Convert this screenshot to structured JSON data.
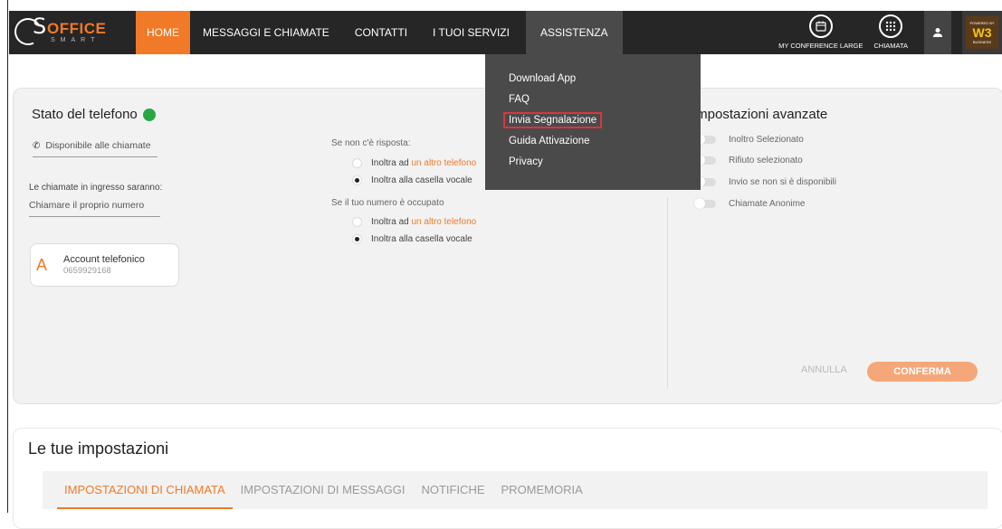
{
  "logo": {
    "s": "S",
    "office": "OFFICE",
    "smart": "SMART"
  },
  "nav": {
    "home": "HOME",
    "messaggi": "MESSAGGI E CHIAMATE",
    "contatti": "CONTATTI",
    "servizi": "I TUOI SERVIZI",
    "assistenza": "ASSISTENZA"
  },
  "tools": {
    "conference": "MY CONFERENCE LARGE",
    "chiamata": "CHIAMATA"
  },
  "brand": {
    "powered": "POWERED BY",
    "w3": "W3",
    "business": "BUSINESS"
  },
  "dropdown": {
    "items": [
      "Download App",
      "FAQ",
      "Invia Segnalazione",
      "Guida Attivazione",
      "Privacy"
    ]
  },
  "stato": {
    "title": "Stato del telefono",
    "status_color": "#27a844",
    "disponibile": "Disponibile alle chiamate",
    "incoming_label": "Le chiamate in ingresso saranno:",
    "incoming_value": "Chiamare il proprio numero",
    "account_title": "Account telefonico",
    "account_number": "0659929168"
  },
  "forwarding": {
    "no_answer_label": "Se non c'è risposta:",
    "no_answer_opt1_prefix": "Inoltra ad ",
    "no_answer_opt1_link": "un altro telefono",
    "no_answer_opt2": "Inoltra alla casella vocale",
    "busy_label": "Se il tuo numero è occupato",
    "busy_opt1_prefix": "Inoltra ad ",
    "busy_opt1_link": "un altro telefono",
    "busy_opt2": "Inoltra alla casella vocale"
  },
  "avanzate": {
    "title": "Impostazioni avanzate",
    "toggles": [
      "Inoltro Selezionato",
      "Rifiuto selezionato",
      "Invio se non si è disponibili",
      "Chiamate Anonime"
    ]
  },
  "buttons": {
    "annulla": "ANNULLA",
    "conferma": "CONFERMA"
  },
  "settings": {
    "title": "Le tue impostazioni",
    "tabs": [
      "IMPOSTAZIONI DI CHIAMATA",
      "IMPOSTAZIONI DI MESSAGGI",
      "NOTIFICHE",
      "PROMEMORIA"
    ]
  },
  "colors": {
    "accent": "#f07a28",
    "nav_bg": "#262626",
    "dropdown_bg": "#4a4a4a"
  }
}
